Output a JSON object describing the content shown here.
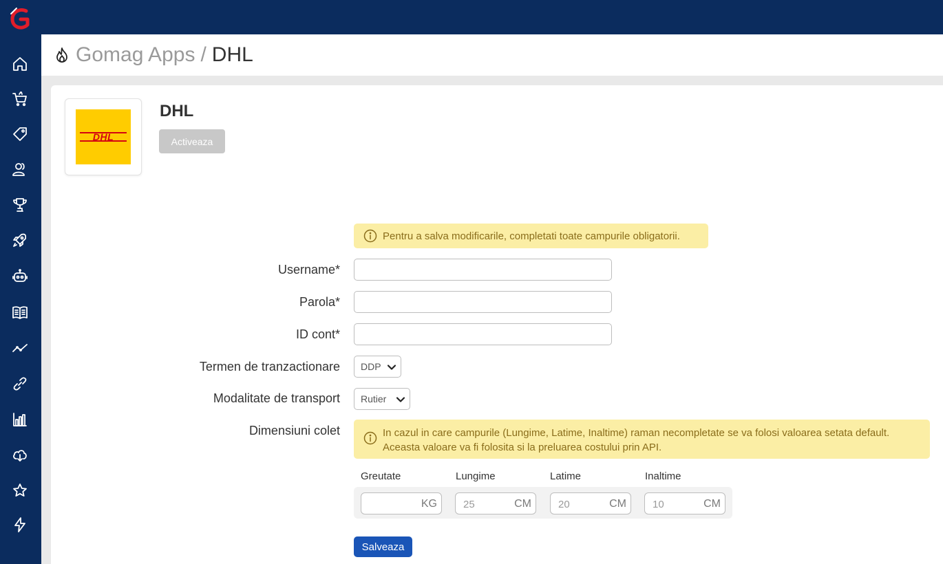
{
  "sidebar": {
    "logo": "gomag-logo",
    "items": [
      {
        "icon": "home-icon"
      },
      {
        "icon": "shopping-cart-icon"
      },
      {
        "icon": "tag-icon"
      },
      {
        "icon": "users-icon"
      },
      {
        "icon": "trophy-icon"
      },
      {
        "icon": "rocket-icon"
      },
      {
        "icon": "robot-icon"
      },
      {
        "icon": "book-icon"
      },
      {
        "icon": "trend-line-icon"
      },
      {
        "icon": "link-icon"
      },
      {
        "icon": "bar-chart-icon"
      },
      {
        "icon": "cloud-download-icon"
      },
      {
        "icon": "star-icon"
      },
      {
        "icon": "lightning-icon"
      }
    ]
  },
  "header": {
    "breadcrumb_parent": "Gomag Apps",
    "breadcrumb_separator": "/",
    "breadcrumb_current": "DHL"
  },
  "app": {
    "name": "DHL",
    "logo_text": "DHL",
    "activate_label": "Activeaza"
  },
  "alerts": {
    "required": "Pentru a salva modificarile, completati toate campurile obligatorii.",
    "dimensions_line1": "In cazul in care campurile (Lungime, Latime, Inaltime) raman necompletate se va folosi valoarea setata default.",
    "dimensions_line2": "Aceasta valoare va fi folosita si la preluarea costului prin API."
  },
  "form": {
    "username_label": "Username*",
    "username_value": "",
    "password_label": "Parola*",
    "password_value": "",
    "account_id_label": "ID cont*",
    "account_id_value": "",
    "trade_term_label": "Termen de tranzactionare",
    "trade_term_value": "DDP",
    "transport_label": "Modalitate de transport",
    "transport_value": "Rutier",
    "dimensions_label": "Dimensiuni colet",
    "dimensions": {
      "weight_label": "Greutate",
      "weight_value": "",
      "weight_unit": "KG",
      "length_label": "Lungime",
      "length_placeholder": "25",
      "length_unit": "CM",
      "width_label": "Latime",
      "width_placeholder": "20",
      "width_unit": "CM",
      "height_label": "Inaltime",
      "height_placeholder": "10",
      "height_unit": "CM"
    },
    "save_label": "Salveaza"
  },
  "colors": {
    "sidebar_bg": "#0b2c5e",
    "primary_button": "#1a55b7",
    "alert_bg": "#fbeea5",
    "dhl_yellow": "#ffcc00",
    "dhl_red": "#d40511"
  }
}
